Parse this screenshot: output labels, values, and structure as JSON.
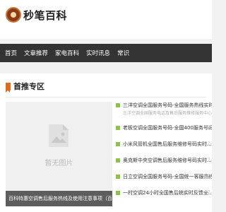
{
  "site": {
    "name": "秒笔百科"
  },
  "nav": [
    "首页",
    "文章推荐",
    "家电百科",
    "实时讯息",
    "常识"
  ],
  "section": {
    "title": "首推专区"
  },
  "featured": {
    "placeholder": "暂无图片",
    "caption": "百科特惠空调售后服务热线及使用注意事项（百科特惠）"
  },
  "news": [
    {
      "title": "三洋空调全国服务号码-全国服务热线实时反馈全...",
      "desc": "三洋空调全国服务电话及售后服务维修服务中心及厂家三洋空调",
      "date": "",
      "highlight": true
    },
    {
      "title": "老板空调全国服务号码-全国400服务号码实...",
      "desc": "",
      "date": "07-",
      "highlight": false
    },
    {
      "title": "小米风管机全国售后服务维修号码实时...",
      "desc": "",
      "date": "07-",
      "highlight": false
    },
    {
      "title": "奥克斯中央空调售后服务维修号码实时...",
      "desc": "",
      "date": "07-",
      "highlight": false
    },
    {
      "title": "日立空调全国服务号码-全国统一客服热线...",
      "desc": "",
      "date": "07-",
      "highlight": false
    },
    {
      "title": "一村空调24小时全国售后统实时反馈全...",
      "desc": "",
      "date": "07-",
      "highlight": false
    }
  ],
  "colors": {
    "nav_bg": "#333333",
    "accent": "#e06a1b",
    "bullet": "#8bc34a"
  }
}
